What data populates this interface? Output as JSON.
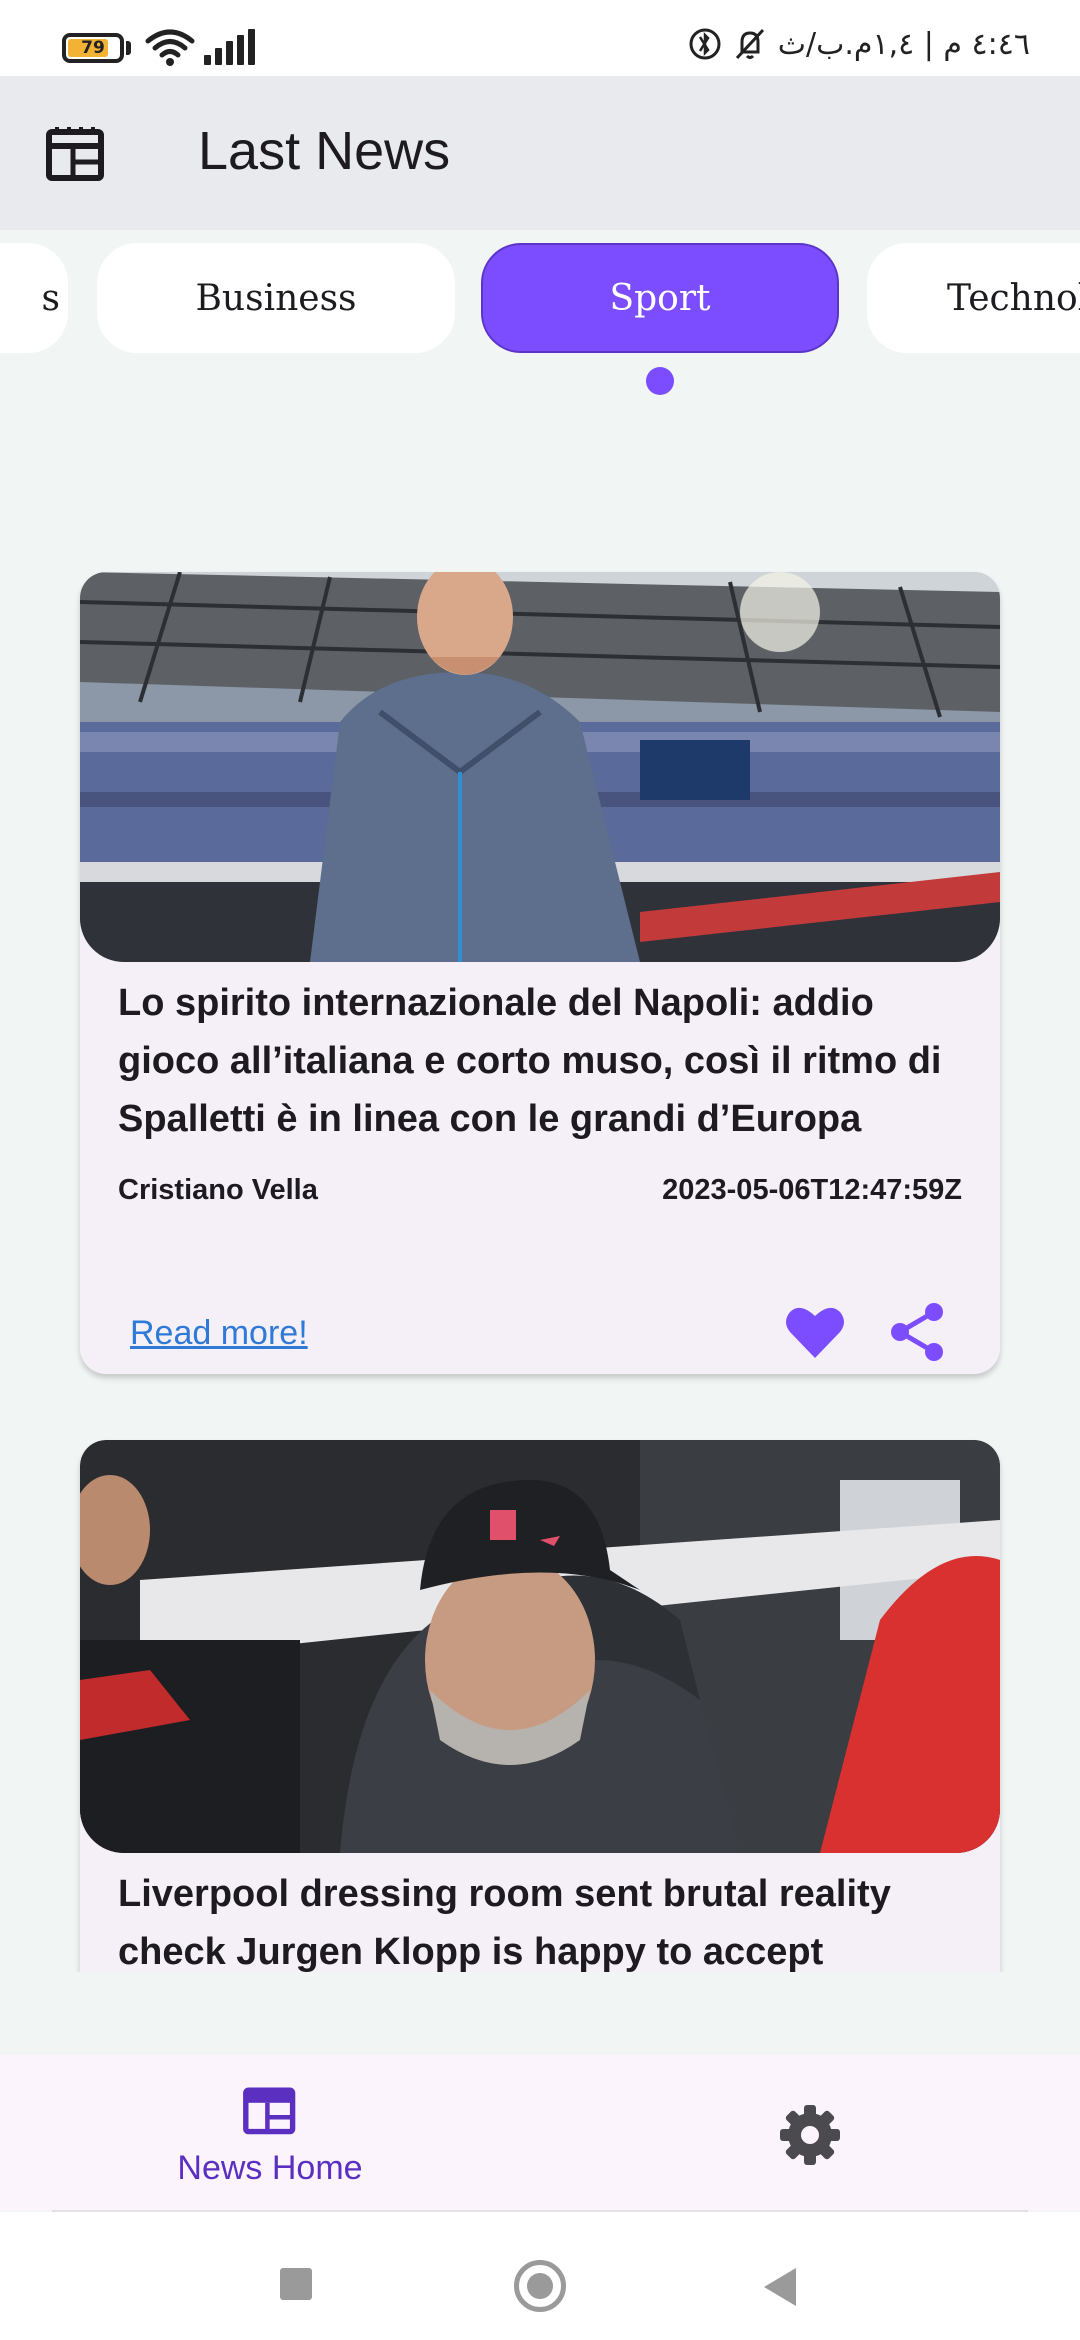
{
  "status_bar": {
    "battery": "79",
    "battery_level": 0.79,
    "time": "٤:٤٦ م | ١,٤م.ب/ث"
  },
  "app_bar": {
    "title": "Last News",
    "icon": "newspaper-icon"
  },
  "categories": [
    {
      "label": "s",
      "selected": false
    },
    {
      "label": "Business",
      "selected": false
    },
    {
      "label": "Sport",
      "selected": true
    },
    {
      "label": "Technol",
      "selected": false
    }
  ],
  "articles": [
    {
      "title": "Lo spirito internazionale del Napoli: addio gioco all’italiana e corto muso, così il ritmo di Spalletti è in linea con le grandi d’Europa",
      "author": "Cristiano Vella",
      "date": "2023-05-06T12:47:59Z",
      "read_more": "Read more!",
      "image": "football-coach-stadium-photo",
      "favorited": true
    },
    {
      "title": "Liverpool dressing room sent brutal reality check Jurgen Klopp is happy to accept",
      "image": "manager-in-cap-photo"
    }
  ],
  "bottom_nav": {
    "home_label": "News Home",
    "home_icon": "newspaper-icon",
    "settings_icon": "gear-icon"
  },
  "colors": {
    "accent": "#7c4dff",
    "link": "#2f7ad6",
    "background": "#f1f5f3",
    "card": "#f5f0f8"
  }
}
